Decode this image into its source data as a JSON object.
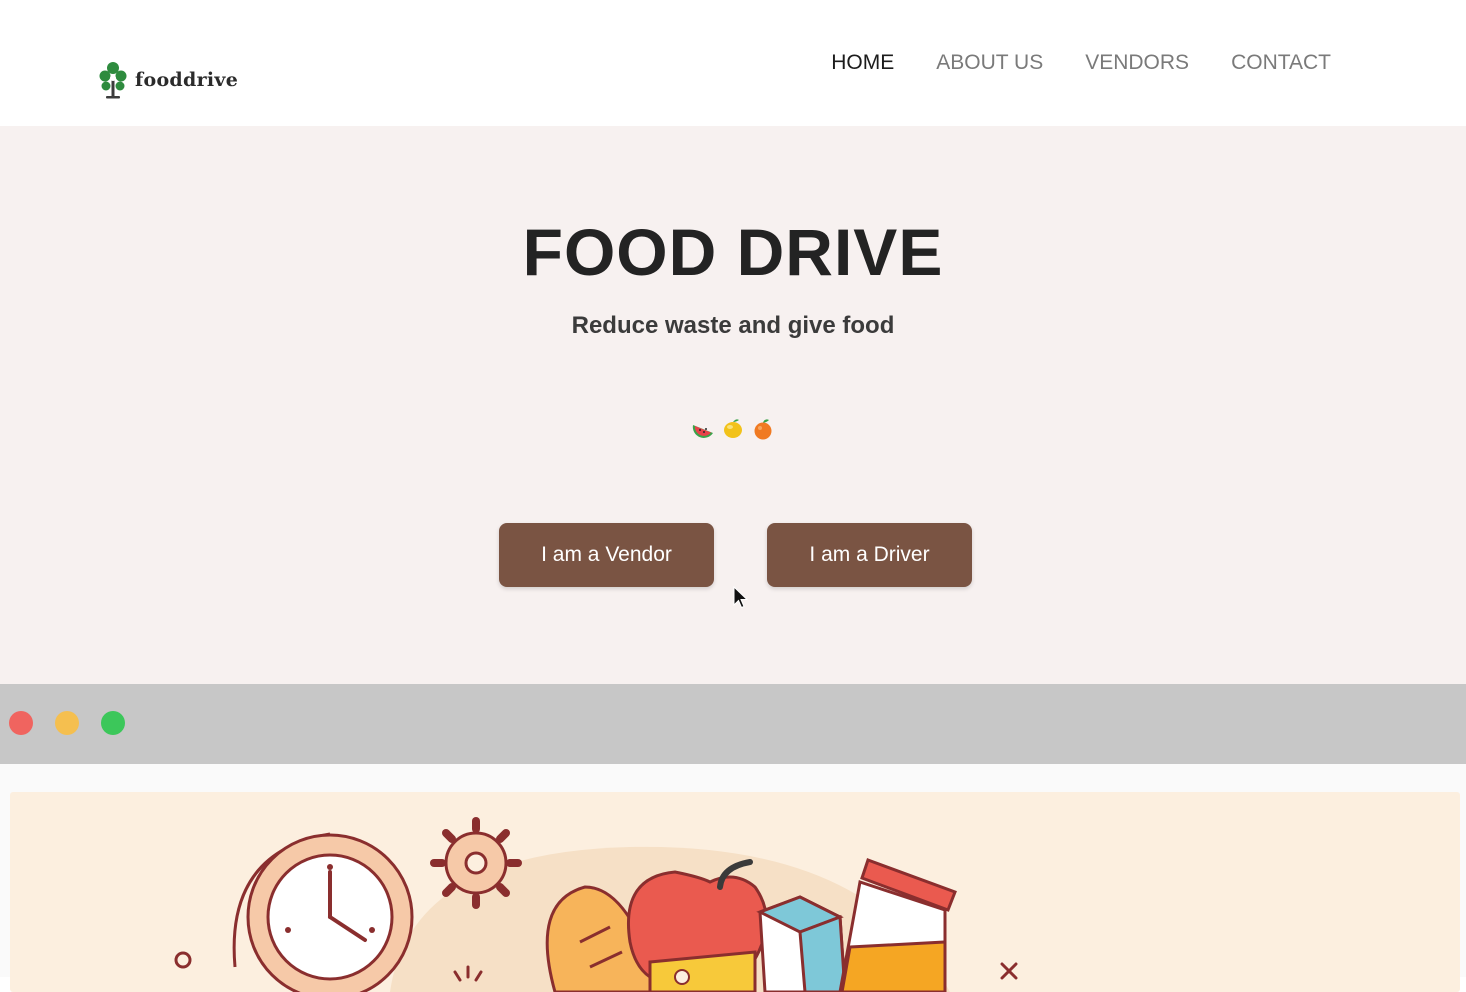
{
  "brand": {
    "name": "fooddrive",
    "icon": "tree-logo-icon",
    "icon_color": "#2e8b3e"
  },
  "nav": {
    "items": [
      {
        "label": "HOME",
        "active": true
      },
      {
        "label": "ABOUT US",
        "active": false
      },
      {
        "label": "VENDORS",
        "active": false
      },
      {
        "label": "CONTACT",
        "active": false
      }
    ]
  },
  "hero": {
    "title": "FOOD DRIVE",
    "subtitle": "Reduce waste and give food",
    "fruit_icons": [
      "watermelon-icon",
      "lemon-icon",
      "orange-icon"
    ],
    "buttons": {
      "vendor": "I am a Vendor",
      "driver": "I am a Driver"
    },
    "background": "#f7f1f0"
  },
  "colors": {
    "button": "#7a5443",
    "window_bar": "#c7c7c7",
    "dot_red": "#f0645f",
    "dot_yellow": "#f5bf4f",
    "dot_green": "#3cc75a",
    "illustration_bg": "#fcefdf"
  },
  "window": {
    "controls": [
      "close-dot",
      "minimize-dot",
      "maximize-dot"
    ],
    "illustration_icons": [
      "clock-icon",
      "gear-icon",
      "bread-icon",
      "apple-icon",
      "milk-carton-icon",
      "juice-jar-icon"
    ]
  }
}
